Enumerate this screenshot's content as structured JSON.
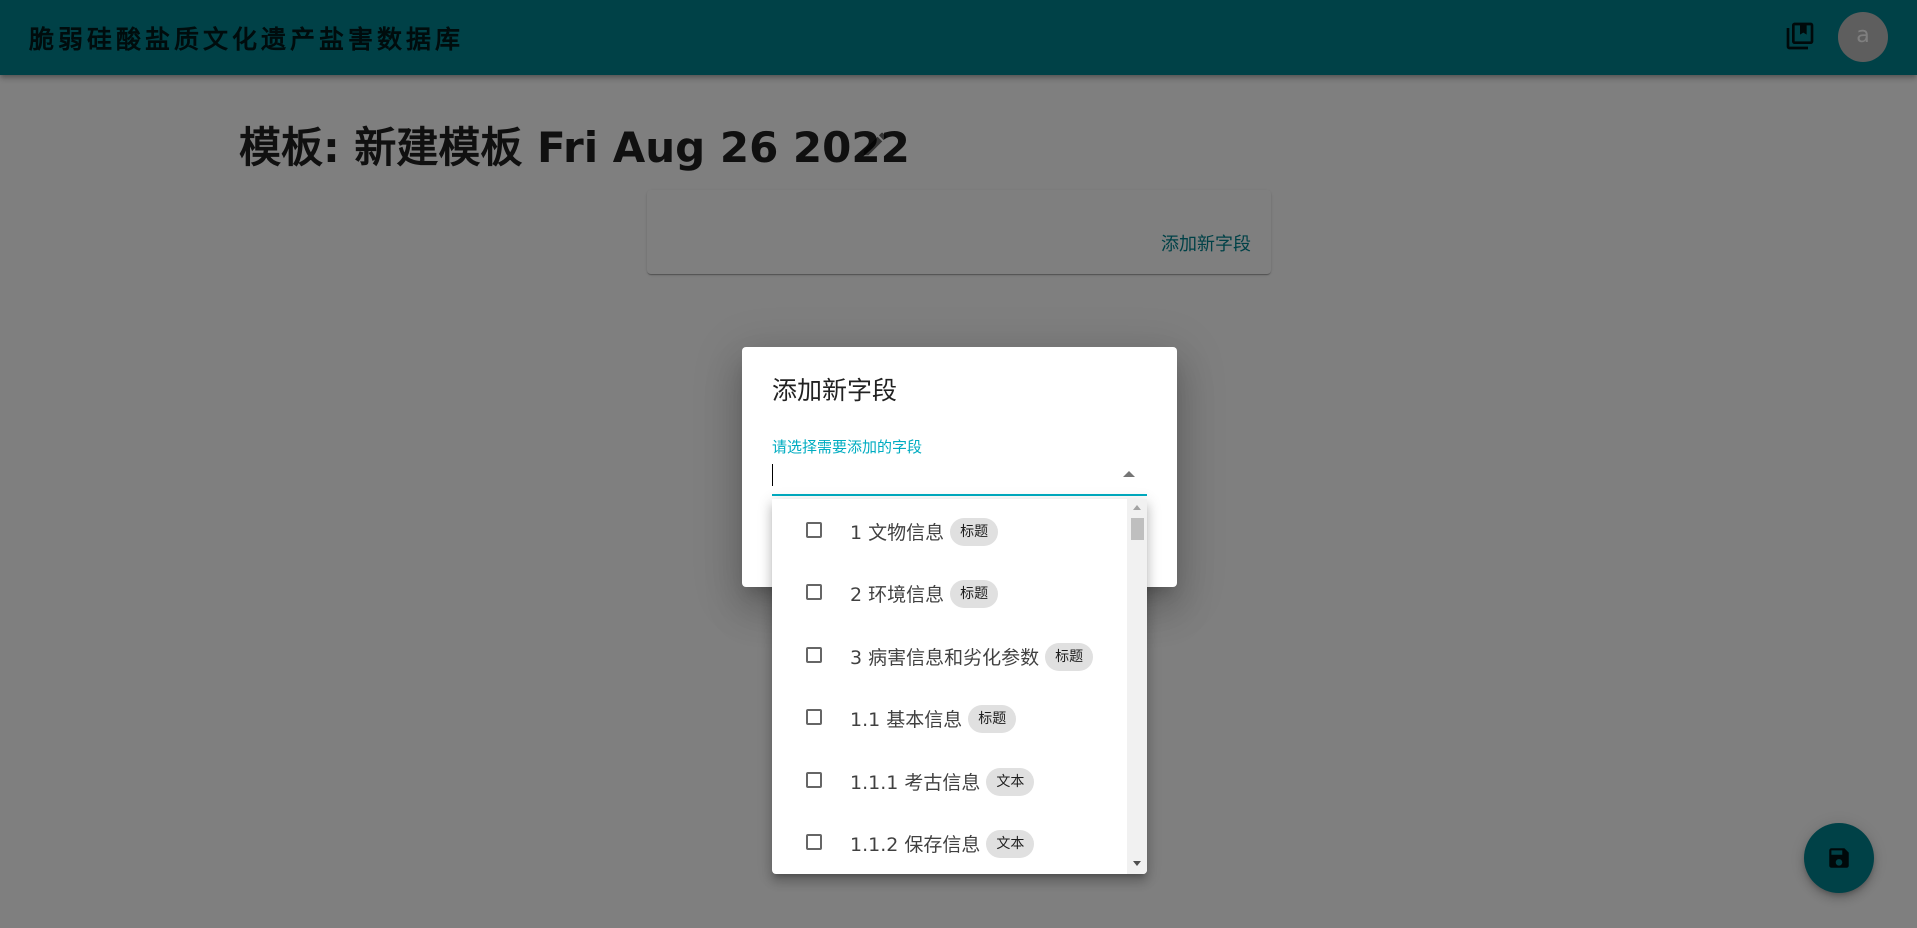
{
  "appbar": {
    "title": "脆弱硅酸盐质文化遗产盐害数据库",
    "library_icon": "library-books-icon",
    "avatar_letter": "a"
  },
  "page": {
    "title": "模板: 新建模板 Fri Aug 26 2022",
    "edit_icon": "pencil-icon",
    "add_field_link": "添加新字段",
    "save_icon": "floppy-disk-icon"
  },
  "dialog": {
    "title": "添加新字段",
    "field_label": "请选择需要添加的字段",
    "input_value": "",
    "options": [
      {
        "label": "1 文物信息",
        "tag": "标题",
        "checked": false
      },
      {
        "label": "2 环境信息",
        "tag": "标题",
        "checked": false
      },
      {
        "label": "3 病害信息和劣化参数",
        "tag": "标题",
        "checked": false
      },
      {
        "label": "1.1 基本信息",
        "tag": "标题",
        "checked": false
      },
      {
        "label": "1.1.1 考古信息",
        "tag": "文本",
        "checked": false
      },
      {
        "label": "1.1.2 保存信息",
        "tag": "文本",
        "checked": false
      }
    ]
  },
  "colors": {
    "primary": "#00838f",
    "accent": "#00acc1",
    "chip_bg": "#e0e0e0"
  }
}
